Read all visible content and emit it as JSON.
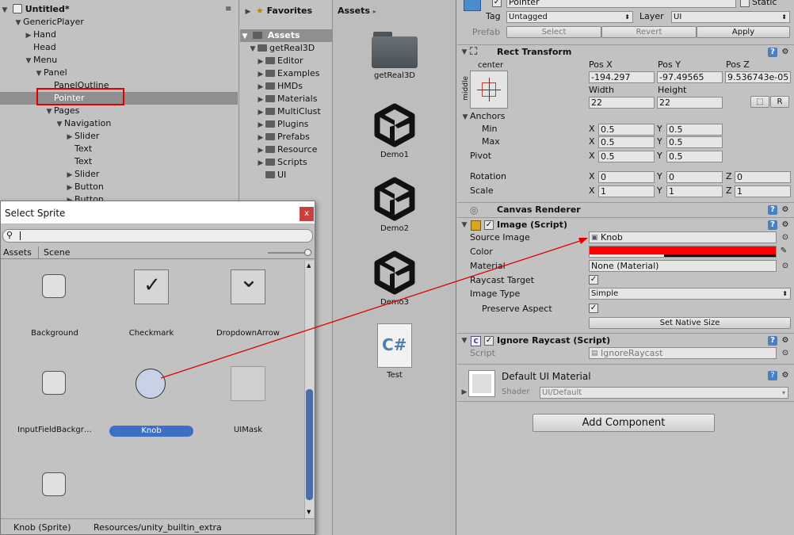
{
  "hierarchy": {
    "title": "Untitled*",
    "items": [
      {
        "label": "GenericPlayer",
        "indent": 1,
        "arrow": "down"
      },
      {
        "label": "Hand",
        "indent": 2,
        "arrow": "right"
      },
      {
        "label": "Head",
        "indent": 2,
        "arrow": ""
      },
      {
        "label": "Menu",
        "indent": 2,
        "arrow": "down"
      },
      {
        "label": "Panel",
        "indent": 3,
        "arrow": "down"
      },
      {
        "label": "PanelOutline",
        "indent": 4,
        "arrow": ""
      },
      {
        "label": "Pointer",
        "indent": 4,
        "arrow": "",
        "selected": true
      },
      {
        "label": "Pages",
        "indent": 4,
        "arrow": "down"
      },
      {
        "label": "Navigation",
        "indent": 5,
        "arrow": "down"
      },
      {
        "label": "Slider",
        "indent": 6,
        "arrow": "right"
      },
      {
        "label": "Text",
        "indent": 6,
        "arrow": ""
      },
      {
        "label": "Text",
        "indent": 6,
        "arrow": ""
      },
      {
        "label": "Slider",
        "indent": 6,
        "arrow": "right"
      },
      {
        "label": "Button",
        "indent": 6,
        "arrow": "right"
      },
      {
        "label": "Button",
        "indent": 6,
        "arrow": "right"
      }
    ]
  },
  "project": {
    "favorites": "Favorites",
    "assets_root": "Assets",
    "folders": [
      {
        "label": "getReal3D",
        "indent": 1,
        "arrow": "down"
      },
      {
        "label": "Editor",
        "indent": 2,
        "arrow": "right"
      },
      {
        "label": "Examples",
        "indent": 2,
        "arrow": "right"
      },
      {
        "label": "HMDs",
        "indent": 2,
        "arrow": "right"
      },
      {
        "label": "Materials",
        "indent": 2,
        "arrow": "right"
      },
      {
        "label": "MultiClust",
        "indent": 2,
        "arrow": "right"
      },
      {
        "label": "Plugins",
        "indent": 2,
        "arrow": "right"
      },
      {
        "label": "Prefabs",
        "indent": 2,
        "arrow": "right"
      },
      {
        "label": "Resource",
        "indent": 2,
        "arrow": "right"
      },
      {
        "label": "Scripts",
        "indent": 2,
        "arrow": "right"
      },
      {
        "label": "UI",
        "indent": 2,
        "arrow": ""
      }
    ],
    "breadcrumb": "Assets",
    "assets": [
      {
        "label": "getReal3D",
        "kind": "folder"
      },
      {
        "label": "Demo1",
        "kind": "unity"
      },
      {
        "label": "Demo2",
        "kind": "unity"
      },
      {
        "label": "Demo3",
        "kind": "unity"
      },
      {
        "label": "Test",
        "kind": "script"
      }
    ]
  },
  "inspector": {
    "object_name": "Pointer",
    "static_label": "Static",
    "tag_label": "Tag",
    "tag_value": "Untagged",
    "layer_label": "Layer",
    "layer_value": "UI",
    "prefab_label": "Prefab",
    "prefab_select": "Select",
    "prefab_revert": "Revert",
    "prefab_apply": "Apply",
    "rect_transform": {
      "title": "Rect Transform",
      "anchor_h": "center",
      "anchor_v": "middle",
      "pos_x_label": "Pos X",
      "pos_y_label": "Pos Y",
      "pos_z_label": "Pos Z",
      "pos_x": "-194.297",
      "pos_y": "-97.49565",
      "pos_z": "9.536743e-05",
      "width_label": "Width",
      "height_label": "Height",
      "width": "22",
      "height": "22",
      "r_btn": "R",
      "anchors_label": "Anchors",
      "min_label": "Min",
      "max_label": "Max",
      "min_x": "0.5",
      "min_y": "0.5",
      "max_x": "0.5",
      "max_y": "0.5",
      "pivot_label": "Pivot",
      "pivot_x": "0.5",
      "pivot_y": "0.5",
      "rotation_label": "Rotation",
      "rot_x": "0",
      "rot_y": "0",
      "rot_z": "0",
      "scale_label": "Scale",
      "scale_x": "1",
      "scale_y": "1",
      "scale_z": "1",
      "x": "X",
      "y": "Y",
      "z": "Z"
    },
    "canvas_renderer": "Canvas Renderer",
    "image": {
      "title": "Image (Script)",
      "source_label": "Source Image",
      "source_value": "Knob",
      "color_label": "Color",
      "color_hex": "#ff0000",
      "material_label": "Material",
      "material_value": "None (Material)",
      "raycast_label": "Raycast Target",
      "image_type_label": "Image Type",
      "image_type_value": "Simple",
      "preserve_label": "Preserve Aspect",
      "native_size_btn": "Set Native Size"
    },
    "ignore_raycast": {
      "title": "Ignore Raycast (Script)",
      "script_label": "Script",
      "script_value": "IgnoreRaycast"
    },
    "material": {
      "title": "Default UI Material",
      "shader_label": "Shader",
      "shader_value": "UI/Default"
    },
    "add_component": "Add Component"
  },
  "dialog": {
    "title": "Select Sprite",
    "close": "x",
    "tab_assets": "Assets",
    "tab_scene": "Scene",
    "sprites": [
      {
        "label": "Background",
        "kind": "rounded"
      },
      {
        "label": "Checkmark",
        "kind": "check"
      },
      {
        "label": "DropdownArrow",
        "kind": "arrow"
      },
      {
        "label": "InputFieldBackgr…",
        "kind": "rounded"
      },
      {
        "label": "Knob",
        "kind": "knob",
        "selected": true
      },
      {
        "label": "UIMask",
        "kind": "mask"
      },
      {
        "label": "",
        "kind": "rounded"
      }
    ],
    "status_name": "Knob (Sprite)",
    "status_path": "Resources/unity_builtin_extra"
  },
  "colors": {
    "annotation": "#e00000",
    "selection": "#3d6fc4"
  }
}
